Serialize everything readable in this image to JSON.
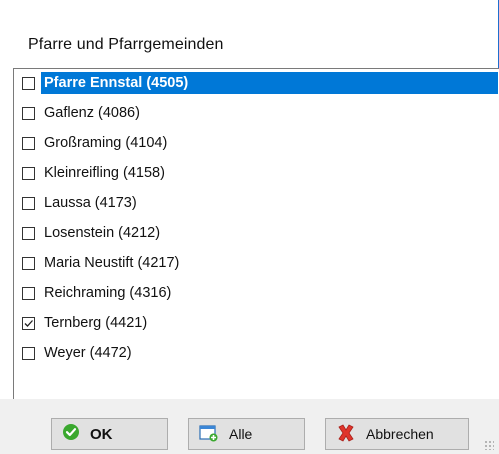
{
  "dialog": {
    "title": "Pfarre und Pfarrgemeinden"
  },
  "list": {
    "items": [
      {
        "label": "Pfarre Ennstal (4505)",
        "checked": false,
        "selected": true
      },
      {
        "label": "Gaflenz (4086)",
        "checked": false,
        "selected": false
      },
      {
        "label": "Großraming (4104)",
        "checked": false,
        "selected": false
      },
      {
        "label": "Kleinreifling (4158)",
        "checked": false,
        "selected": false
      },
      {
        "label": "Laussa (4173)",
        "checked": false,
        "selected": false
      },
      {
        "label": "Losenstein (4212)",
        "checked": false,
        "selected": false
      },
      {
        "label": "Maria Neustift (4217)",
        "checked": false,
        "selected": false
      },
      {
        "label": "Reichraming (4316)",
        "checked": false,
        "selected": false
      },
      {
        "label": "Ternberg (4421)",
        "checked": true,
        "selected": false
      },
      {
        "label": "Weyer (4472)",
        "checked": false,
        "selected": false
      }
    ]
  },
  "buttons": {
    "ok_label": "OK",
    "all_label": "Alle",
    "cancel_label": "Abbrechen"
  },
  "icons": {
    "ok": "check-circle-icon",
    "all": "add-window-icon",
    "cancel": "red-x-icon"
  },
  "colors": {
    "selection": "#0078d7",
    "accent_border": "#1e6fd0"
  }
}
